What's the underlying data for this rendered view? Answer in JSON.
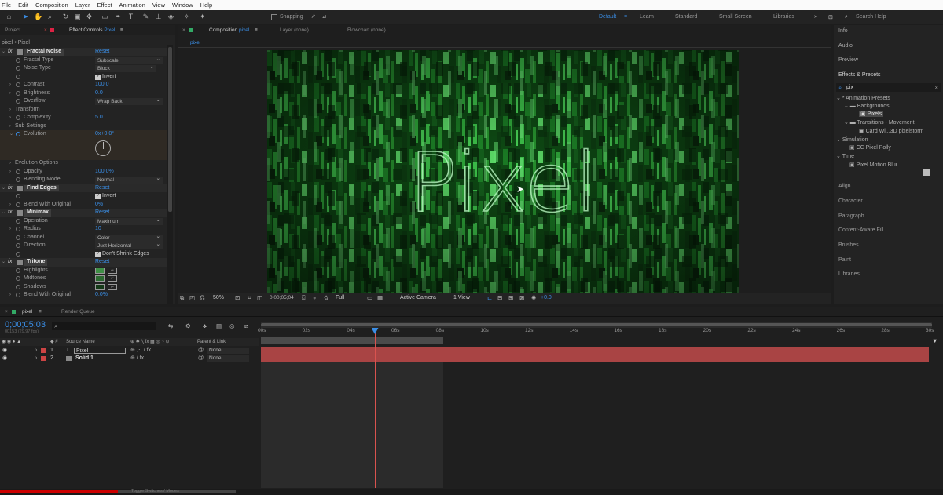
{
  "menu": [
    "File",
    "Edit",
    "Composition",
    "Layer",
    "Effect",
    "Animation",
    "View",
    "Window",
    "Help"
  ],
  "toolbar": {
    "snapping": "Snapping",
    "workspaces": [
      "Default",
      "Learn",
      "Standard",
      "Small Screen",
      "Libraries"
    ],
    "search_help": "Search Help"
  },
  "project_panel": {
    "tab": "Project"
  },
  "effect_controls": {
    "tab": "Effect Controls",
    "tab_target": "Pixel",
    "subtitle": "pixel • Pixel",
    "reset": "Reset",
    "fractal_noise": {
      "name": "Fractal Noise",
      "fractal_type_label": "Fractal Type",
      "fractal_type": "Subscale",
      "noise_type_label": "Noise Type",
      "noise_type": "Block",
      "invert_label": "Invert",
      "contrast_label": "Contrast",
      "contrast": "100.0",
      "brightness_label": "Brightness",
      "brightness": "0.0",
      "overflow_label": "Overflow",
      "overflow": "Wrap Back",
      "transform_label": "Transform",
      "complexity_label": "Complexity",
      "complexity": "5.0",
      "sub_settings_label": "Sub Settings",
      "evolution_label": "Evolution",
      "evolution": "0x+0.0°",
      "evolution_options_label": "Evolution Options",
      "opacity_label": "Opacity",
      "opacity": "100.0%",
      "blending_mode_label": "Blending Mode",
      "blending_mode": "Normal"
    },
    "find_edges": {
      "name": "Find Edges",
      "invert_label": "Invert",
      "blend_label": "Blend With Original",
      "blend": "0%"
    },
    "minimax": {
      "name": "Minimax",
      "operation_label": "Operation",
      "operation": "Maximum",
      "radius_label": "Radius",
      "radius": "10",
      "channel_label": "Channel",
      "channel": "Color",
      "direction_label": "Direction",
      "direction": "Just Horizontal",
      "dont_shrink_label": "Don't Shrink Edges"
    },
    "tritone": {
      "name": "Tritone",
      "highlights_label": "Highlights",
      "midtones_label": "Midtones",
      "shadows_label": "Shadows",
      "blend_label": "Blend With Original",
      "blend": "0.0%"
    }
  },
  "composition": {
    "tab": "Composition",
    "tab_target": "pixel",
    "layer_tab": "Layer (none)",
    "flowchart_tab": "Flowchart (none)",
    "sub_tab": "pixel",
    "canvas_text": "Pixel",
    "zoom": "50%",
    "timecode": "0;00;05;04",
    "resolution": "Full",
    "camera": "Active Camera",
    "views": "1 View",
    "exposure": "+0.0"
  },
  "right_panels": {
    "info": "Info",
    "audio": "Audio",
    "preview": "Preview",
    "effects_presets": "Effects & Presets",
    "search_value": "pix",
    "tree": [
      "* Animation Presets",
      "Backgrounds",
      "Pixels",
      "Transitions - Movement",
      "Card Wi...3D pixelstorm",
      "Simulation",
      "CC Pixel Polly",
      "Time",
      "Pixel Motion Blur"
    ],
    "lower": [
      "Align",
      "Character",
      "Paragraph",
      "Content-Aware Fill",
      "Brushes",
      "Paint",
      "Libraries"
    ]
  },
  "timeline": {
    "tab": "pixel",
    "render_queue": "Render Queue",
    "timecode": "0;00;05;03",
    "fps": "00153 (29.97 fps)",
    "source_name_header": "Source Name",
    "parent_header": "Parent & Link",
    "layers": [
      {
        "num": "1",
        "type": "T",
        "name": "Pixel",
        "parent": "None"
      },
      {
        "num": "2",
        "type": "",
        "name": "Solid 1",
        "parent": "None"
      }
    ],
    "ruler": [
      "00s",
      "02s",
      "04s",
      "06s",
      "08s",
      "10s",
      "12s",
      "14s",
      "16s",
      "18s",
      "20s",
      "22s",
      "24s",
      "26s",
      "28s",
      "30s"
    ],
    "footer": "Toggle Switches / Modes",
    "playhead_seconds": 5.1,
    "work_area_end_seconds": 8.2,
    "duration_seconds": 30
  },
  "colors": {
    "accent_blue": "#3a8ee6",
    "layer_bar": "#a94444",
    "highlight_swatch": "#3f8f46",
    "midtone_swatch": "#2c6a31",
    "shadow_swatch": "#153a18"
  }
}
